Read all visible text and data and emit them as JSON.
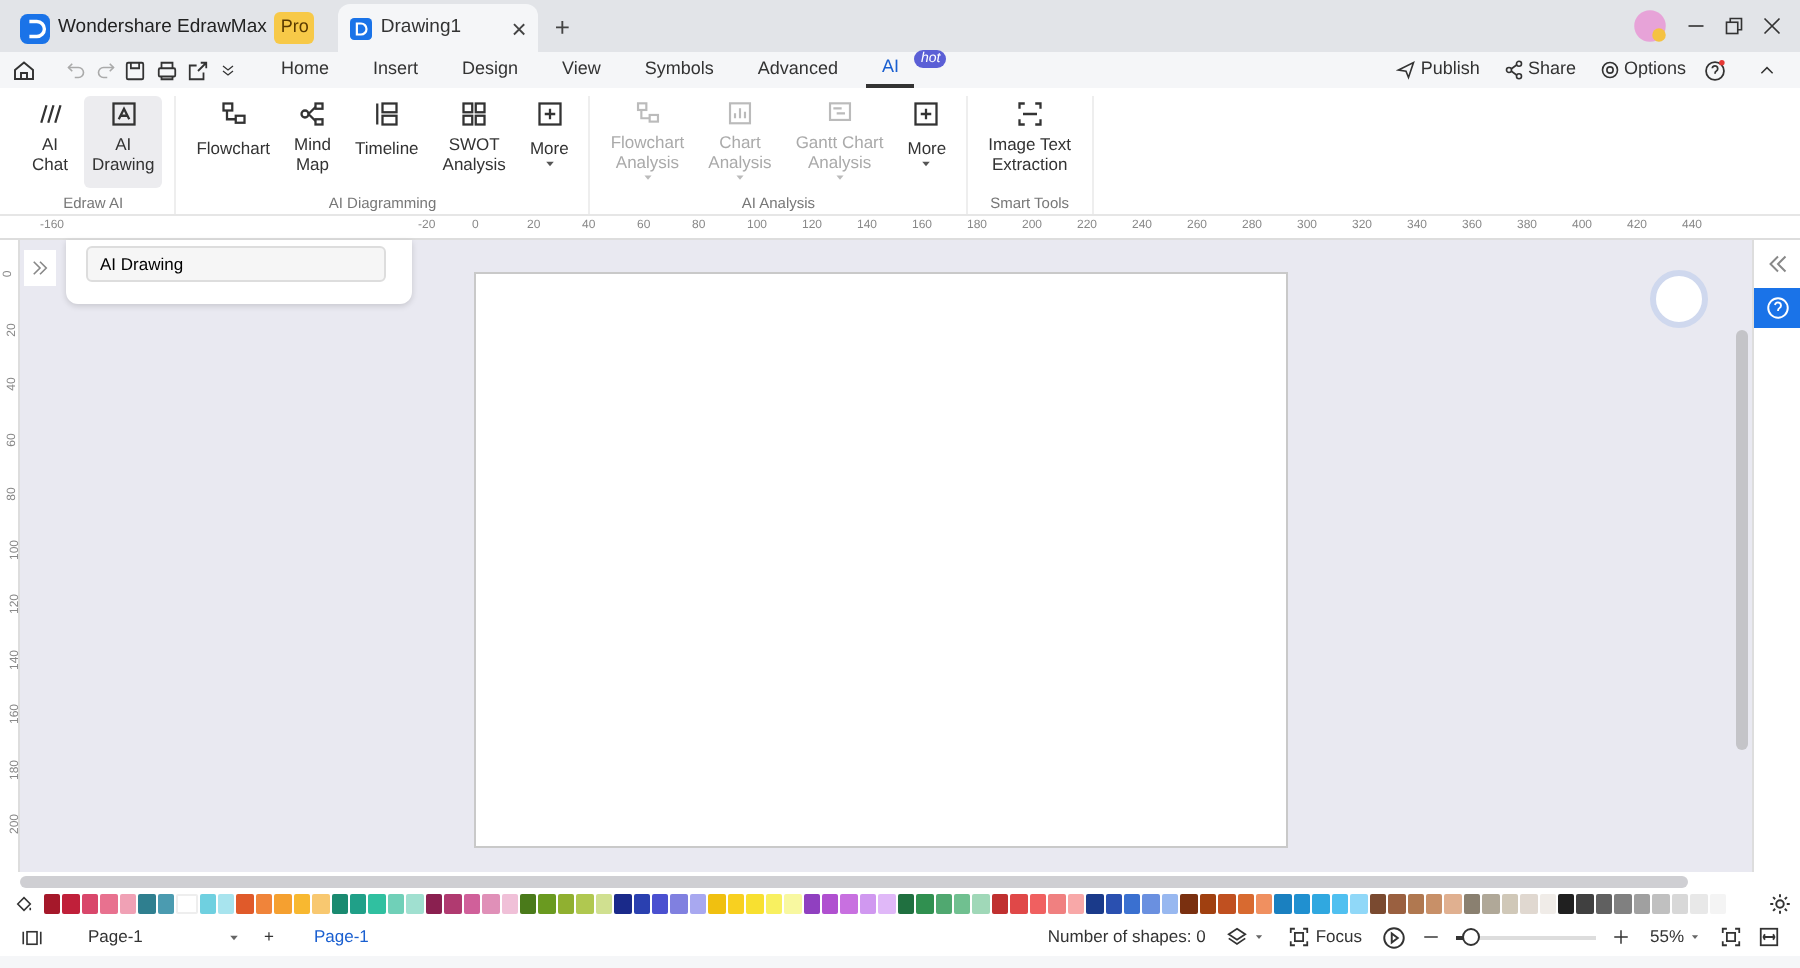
{
  "app_tab": {
    "title": "Wondershare EdrawMax",
    "badge": "Pro"
  },
  "doc_tab": {
    "title": "Drawing1",
    "close": "×"
  },
  "new_tab": "+",
  "menu_tabs": [
    {
      "label": "Home",
      "selected": false
    },
    {
      "label": "Insert",
      "selected": false
    },
    {
      "label": "Design",
      "selected": false
    },
    {
      "label": "View",
      "selected": false
    },
    {
      "label": "Symbols",
      "selected": false
    },
    {
      "label": "Advanced",
      "selected": false
    },
    {
      "label": "AI",
      "selected": true,
      "badge": "hot"
    }
  ],
  "actions": [
    {
      "kind": "publish",
      "label": "Publish"
    },
    {
      "kind": "share",
      "label": "Share"
    },
    {
      "kind": "options",
      "label": "Options"
    }
  ],
  "ribbon_groups": [
    {
      "label": "Edraw AI",
      "tools": [
        {
          "kind": "ai-chat",
          "lines": [
            "AI",
            "Chat"
          ],
          "selected": false,
          "disabled": false,
          "dropdown": false
        },
        {
          "kind": "ai-drawing",
          "lines": [
            "AI",
            "Drawing"
          ],
          "selected": true,
          "disabled": false,
          "dropdown": false
        }
      ]
    },
    {
      "label": "AI Diagramming",
      "tools": [
        {
          "kind": "flowchart",
          "lines": [
            "Flowchart"
          ],
          "selected": false,
          "disabled": false,
          "dropdown": false
        },
        {
          "kind": "mindmap",
          "lines": [
            "Mind",
            "Map"
          ],
          "selected": false,
          "disabled": false,
          "dropdown": false
        },
        {
          "kind": "timeline",
          "lines": [
            "Timeline"
          ],
          "selected": false,
          "disabled": false,
          "dropdown": false
        },
        {
          "kind": "swot",
          "lines": [
            "SWOT",
            "Analysis"
          ],
          "selected": false,
          "disabled": false,
          "dropdown": false
        },
        {
          "kind": "more",
          "lines": [
            "More"
          ],
          "selected": false,
          "disabled": false,
          "dropdown": true
        }
      ]
    },
    {
      "label": "AI Analysis",
      "tools": [
        {
          "kind": "flowchart-analysis",
          "lines": [
            "Flowchart",
            "Analysis"
          ],
          "selected": false,
          "disabled": true,
          "dropdown": true
        },
        {
          "kind": "chart",
          "lines": [
            "Chart",
            "Analysis"
          ],
          "selected": false,
          "disabled": true,
          "dropdown": true
        },
        {
          "kind": "gantt",
          "lines": [
            "Gantt Chart",
            "Analysis"
          ],
          "selected": false,
          "disabled": true,
          "dropdown": true
        },
        {
          "kind": "more",
          "lines": [
            "More"
          ],
          "selected": false,
          "disabled": false,
          "dropdown": true
        }
      ]
    },
    {
      "label": "Smart Tools",
      "tools": [
        {
          "kind": "ocr",
          "lines": [
            "Image Text",
            "Extraction"
          ],
          "selected": false,
          "disabled": false,
          "dropdown": false
        }
      ]
    }
  ],
  "ruler_h": [
    "-160",
    "-20",
    "0",
    "20",
    "40",
    "60",
    "80",
    "100",
    "120",
    "140",
    "160",
    "180",
    "200",
    "220",
    "240",
    "260",
    "280",
    "300",
    "320",
    "340",
    "360",
    "380",
    "400",
    "420",
    "440"
  ],
  "ruler_v": [
    "0",
    "20",
    "40",
    "60",
    "80",
    "100",
    "120",
    "140",
    "160",
    "180",
    "200"
  ],
  "ai_panel": {
    "value": "AI Drawing"
  },
  "palette": [
    {
      "color": "#a5182a"
    },
    {
      "color": "#c0203a"
    },
    {
      "color": "#d9476b"
    },
    {
      "color": "#e8718f"
    },
    {
      "color": "#f0a1b5"
    },
    {
      "color": "#2f7f8f"
    },
    {
      "color": "#4b9bb0"
    },
    {
      "color": "#ffffff"
    },
    {
      "color": "#6fd0e0"
    },
    {
      "color": "#a8e4ee"
    },
    {
      "color": "#e05a2a"
    },
    {
      "color": "#f0843a"
    },
    {
      "color": "#f5a030"
    },
    {
      "color": "#f8b830"
    },
    {
      "color": "#f8c870"
    },
    {
      "color": "#1a8a70"
    },
    {
      "color": "#20a088"
    },
    {
      "color": "#30c0a0"
    },
    {
      "color": "#70d0b8"
    },
    {
      "color": "#a0e0d0"
    },
    {
      "color": "#8a2050"
    },
    {
      "color": "#b03a70"
    },
    {
      "color": "#d0609a"
    },
    {
      "color": "#e090b8"
    },
    {
      "color": "#f0c0d8"
    },
    {
      "color": "#4a7a1a"
    },
    {
      "color": "#6a9a20"
    },
    {
      "color": "#90b030"
    },
    {
      "color": "#b0c850"
    },
    {
      "color": "#d0e090"
    },
    {
      "color": "#1a2a8a"
    },
    {
      "color": "#2a40b0"
    },
    {
      "color": "#4a50d0"
    },
    {
      "color": "#8080e0"
    },
    {
      "color": "#a8a8f0"
    },
    {
      "color": "#f0c010"
    },
    {
      "color": "#f8d020"
    },
    {
      "color": "#f8e030"
    },
    {
      "color": "#f8f060"
    },
    {
      "color": "#f8f8a0"
    },
    {
      "color": "#9040c0"
    },
    {
      "color": "#b050d0"
    },
    {
      "color": "#c870e0"
    },
    {
      "color": "#d098f0"
    },
    {
      "color": "#e0b8f8"
    },
    {
      "color": "#207040"
    },
    {
      "color": "#309050"
    },
    {
      "color": "#50a870"
    },
    {
      "color": "#70c090"
    },
    {
      "color": "#a0d8b8"
    },
    {
      "color": "#c03030"
    },
    {
      "color": "#e04848"
    },
    {
      "color": "#f06060"
    },
    {
      "color": "#f08080"
    },
    {
      "color": "#f8a8a8"
    },
    {
      "color": "#1a3a8a"
    },
    {
      "color": "#2a50b0"
    },
    {
      "color": "#3a70d0"
    },
    {
      "color": "#6a90e0"
    },
    {
      "color": "#98b8f0"
    },
    {
      "color": "#7a3010"
    },
    {
      "color": "#a04010"
    },
    {
      "color": "#c05020"
    },
    {
      "color": "#d86a30"
    },
    {
      "color": "#f09060"
    },
    {
      "color": "#1a80c0"
    },
    {
      "color": "#2090d0"
    },
    {
      "color": "#30a8e0"
    },
    {
      "color": "#50c0f0"
    },
    {
      "color": "#90d8f8"
    },
    {
      "color": "#7a4a30"
    },
    {
      "color": "#9a6040"
    },
    {
      "color": "#b07850"
    },
    {
      "color": "#c89068"
    },
    {
      "color": "#e0b090"
    },
    {
      "color": "#8a8070"
    },
    {
      "color": "#b0a898"
    },
    {
      "color": "#d0c8b8"
    },
    {
      "color": "#e0d8d0"
    },
    {
      "color": "#f0ece8"
    },
    {
      "color": "#202020"
    },
    {
      "color": "#404040"
    },
    {
      "color": "#606060"
    },
    {
      "color": "#808080"
    },
    {
      "color": "#a0a0a0"
    },
    {
      "color": "#c0c0c0"
    },
    {
      "color": "#d8d8d8"
    },
    {
      "color": "#e8e8e8"
    },
    {
      "color": "#f4f4f4"
    }
  ],
  "status": {
    "page_select": "Page-1",
    "add_page": "+",
    "pages": [
      {
        "label": "Page-1",
        "selected": true
      }
    ],
    "shapes": "Number of shapes: 0",
    "focus": "Focus",
    "zoom": {
      "level": 0.12,
      "reading": "55%"
    }
  }
}
